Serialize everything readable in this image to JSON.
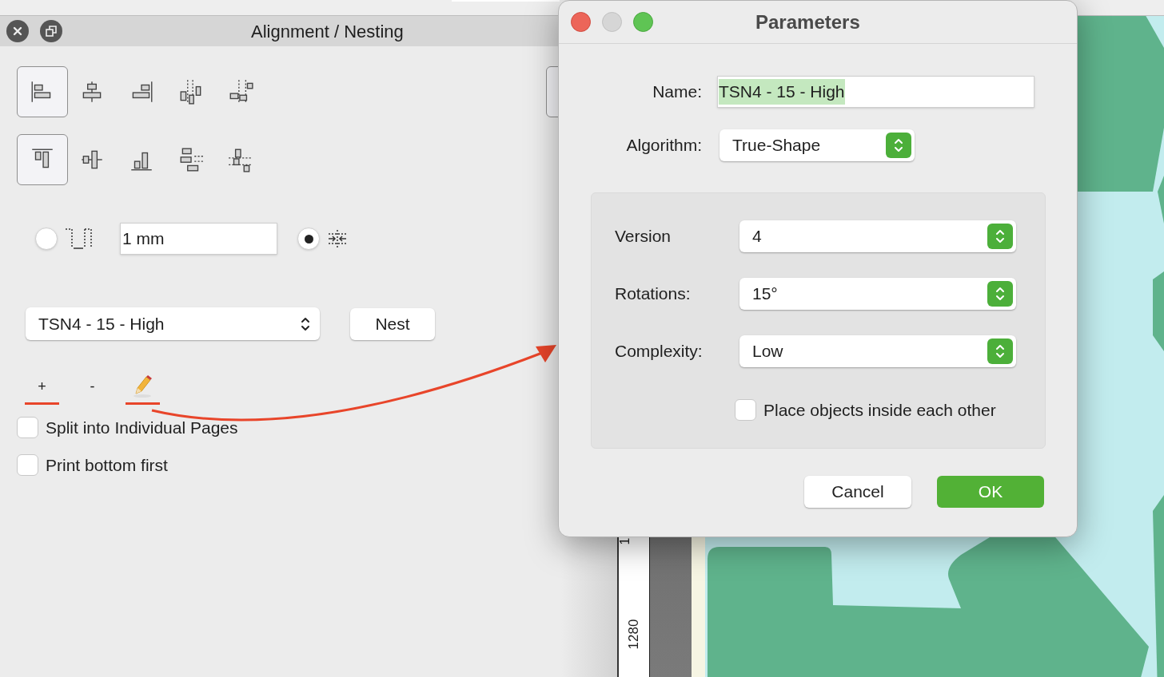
{
  "panel": {
    "title": "Alignment / Nesting",
    "align_rows": [
      [
        {
          "kind": "left",
          "selected": true
        },
        {
          "kind": "hcenter",
          "selected": false
        },
        {
          "kind": "right",
          "selected": false
        },
        {
          "kind": "hdistribute",
          "selected": false
        },
        {
          "kind": "hstep",
          "selected": false
        }
      ],
      [
        {
          "kind": "top",
          "selected": true
        },
        {
          "kind": "vcenter",
          "selected": false
        },
        {
          "kind": "bottom",
          "selected": false
        },
        {
          "kind": "vdistribute",
          "selected": false
        },
        {
          "kind": "vstep",
          "selected": false
        }
      ]
    ],
    "spacing": {
      "options": [
        {
          "kind": "gap",
          "selected": false
        },
        {
          "kind": "fit",
          "selected": true
        }
      ],
      "value": "1 mm"
    },
    "preset": {
      "value": "TSN4 - 15 - High"
    },
    "nest_button": "Nest",
    "list_buttons": [
      {
        "kind": "text",
        "label": "+",
        "underlined": true
      },
      {
        "kind": "text",
        "label": "-",
        "underlined": false
      },
      {
        "kind": "pencil",
        "underlined": true
      }
    ],
    "checkboxes": [
      {
        "label": "Split into Individual Pages",
        "checked": false
      },
      {
        "label": "Print bottom first",
        "checked": false
      }
    ]
  },
  "dialog": {
    "title": "Parameters",
    "name_label": "Name:",
    "name_value": "TSN4 - 15 - High",
    "name_selected": true,
    "algorithm_label": "Algorithm:",
    "algorithm_value": "True-Shape",
    "settings": [
      {
        "label": "Version",
        "value": "4"
      },
      {
        "label": "Rotations:",
        "value": "15°"
      },
      {
        "label": "Complexity:",
        "value": "Low"
      }
    ],
    "checkbox": {
      "label": "Place objects inside each other",
      "checked": false
    },
    "buttons": [
      {
        "label": "Cancel",
        "kind": "default"
      },
      {
        "label": "OK",
        "kind": "primary"
      }
    ]
  },
  "ruler": {
    "labels": [
      "1",
      "1280"
    ]
  }
}
